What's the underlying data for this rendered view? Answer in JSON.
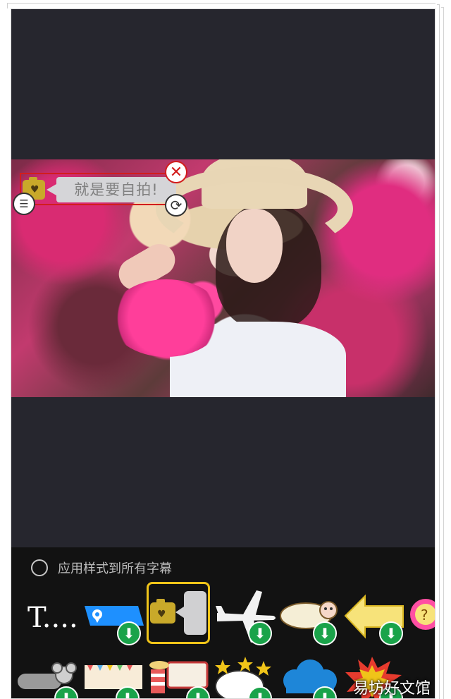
{
  "subtitle_sticker": {
    "text": "就是要自拍!",
    "icon": "camera-heart-icon"
  },
  "controls": {
    "close_icon": "✕",
    "rotate_icon": "⟳",
    "menu_icon": "☰"
  },
  "apply_all": {
    "label": "应用样式到所有字幕",
    "checked": false
  },
  "styles_row1": [
    {
      "name": "style-text",
      "label": "T....",
      "download": false
    },
    {
      "name": "style-location-tag",
      "download": true
    },
    {
      "name": "style-camera-bubble",
      "selected": true,
      "download": false
    },
    {
      "name": "style-airplane",
      "download": true
    },
    {
      "name": "style-sheep-cloud",
      "download": true
    },
    {
      "name": "style-yellow-arrow",
      "download": true
    },
    {
      "name": "style-question-badge",
      "label": "?",
      "download": false
    }
  ],
  "styles_row2": [
    {
      "name": "style-mouse-tag",
      "download": true
    },
    {
      "name": "style-bunting-banner",
      "download": true
    },
    {
      "name": "style-circus-board",
      "download": true
    },
    {
      "name": "style-star-bubble",
      "download": true
    },
    {
      "name": "style-blue-cloud",
      "download": true
    },
    {
      "name": "style-burst",
      "download": true
    }
  ],
  "download_icon": "⬇",
  "watermark": "易坊好文馆",
  "colors": {
    "accent": "#f0c419",
    "download": "#1aa34a",
    "sticker_border": "#d21d1d"
  }
}
